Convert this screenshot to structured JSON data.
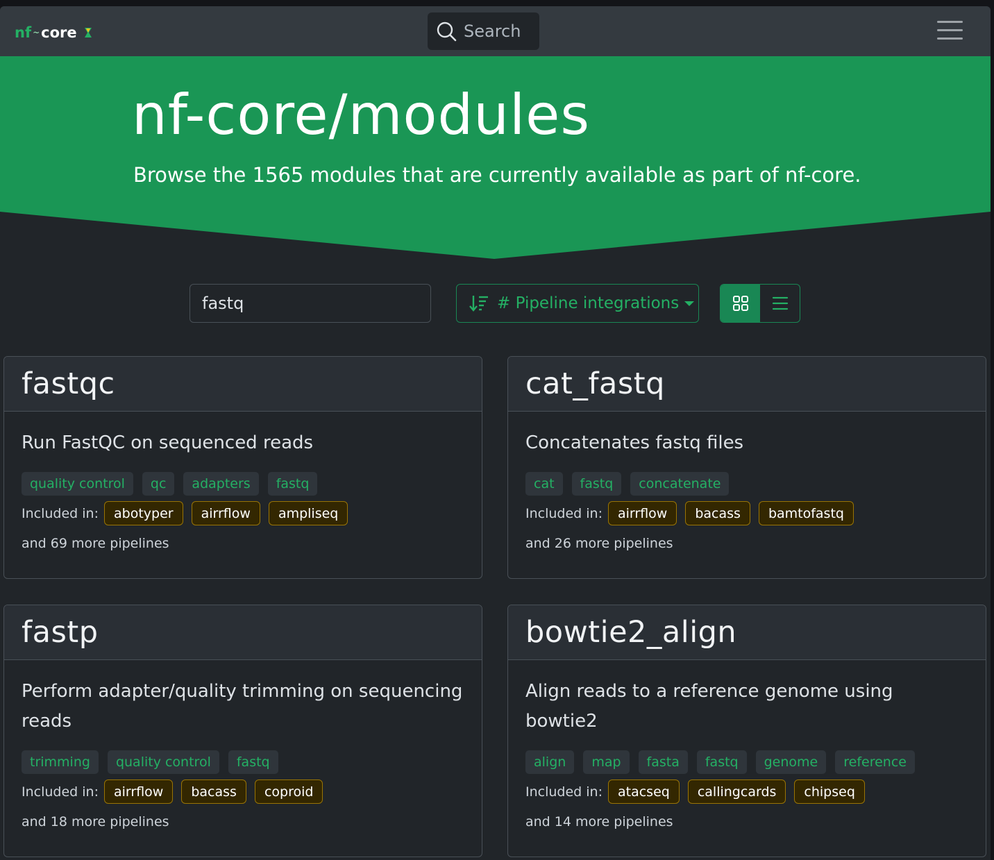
{
  "navbar": {
    "logo_prefix": "nf",
    "logo_suffix": "core",
    "search_label": "Search"
  },
  "hero": {
    "title": "nf-core/modules",
    "subtitle": "Browse the 1565 modules that are currently available as part of nf-core."
  },
  "controls": {
    "filter_value": "fastq",
    "sort_label": "# Pipeline integrations",
    "view_modes": [
      "grid",
      "list"
    ],
    "active_view": "grid"
  },
  "colors": {
    "brand_green": "#198754",
    "hero_green": "#1a9655",
    "tag_text": "#24b064"
  },
  "included_label": "Included in:",
  "modules": [
    {
      "name": "fastqc",
      "description": "Run FastQC on sequenced reads",
      "tags": [
        "quality control",
        "qc",
        "adapters",
        "fastq"
      ],
      "pipelines": [
        "abotyper",
        "airrflow",
        "ampliseq"
      ],
      "more": "and 69 more pipelines"
    },
    {
      "name": "cat_fastq",
      "description": "Concatenates fastq files",
      "tags": [
        "cat",
        "fastq",
        "concatenate"
      ],
      "pipelines": [
        "airrflow",
        "bacass",
        "bamtofastq"
      ],
      "more": "and 26 more pipelines"
    },
    {
      "name": "fastp",
      "description": "Perform adapter/quality trimming on sequencing reads",
      "tags": [
        "trimming",
        "quality control",
        "fastq"
      ],
      "pipelines": [
        "airrflow",
        "bacass",
        "coproid"
      ],
      "more": "and 18 more pipelines"
    },
    {
      "name": "bowtie2_align",
      "description": "Align reads to a reference genome using bowtie2",
      "tags": [
        "align",
        "map",
        "fasta",
        "fastq",
        "genome",
        "reference"
      ],
      "pipelines": [
        "atacseq",
        "callingcards",
        "chipseq"
      ],
      "more": "and 14 more pipelines"
    }
  ]
}
